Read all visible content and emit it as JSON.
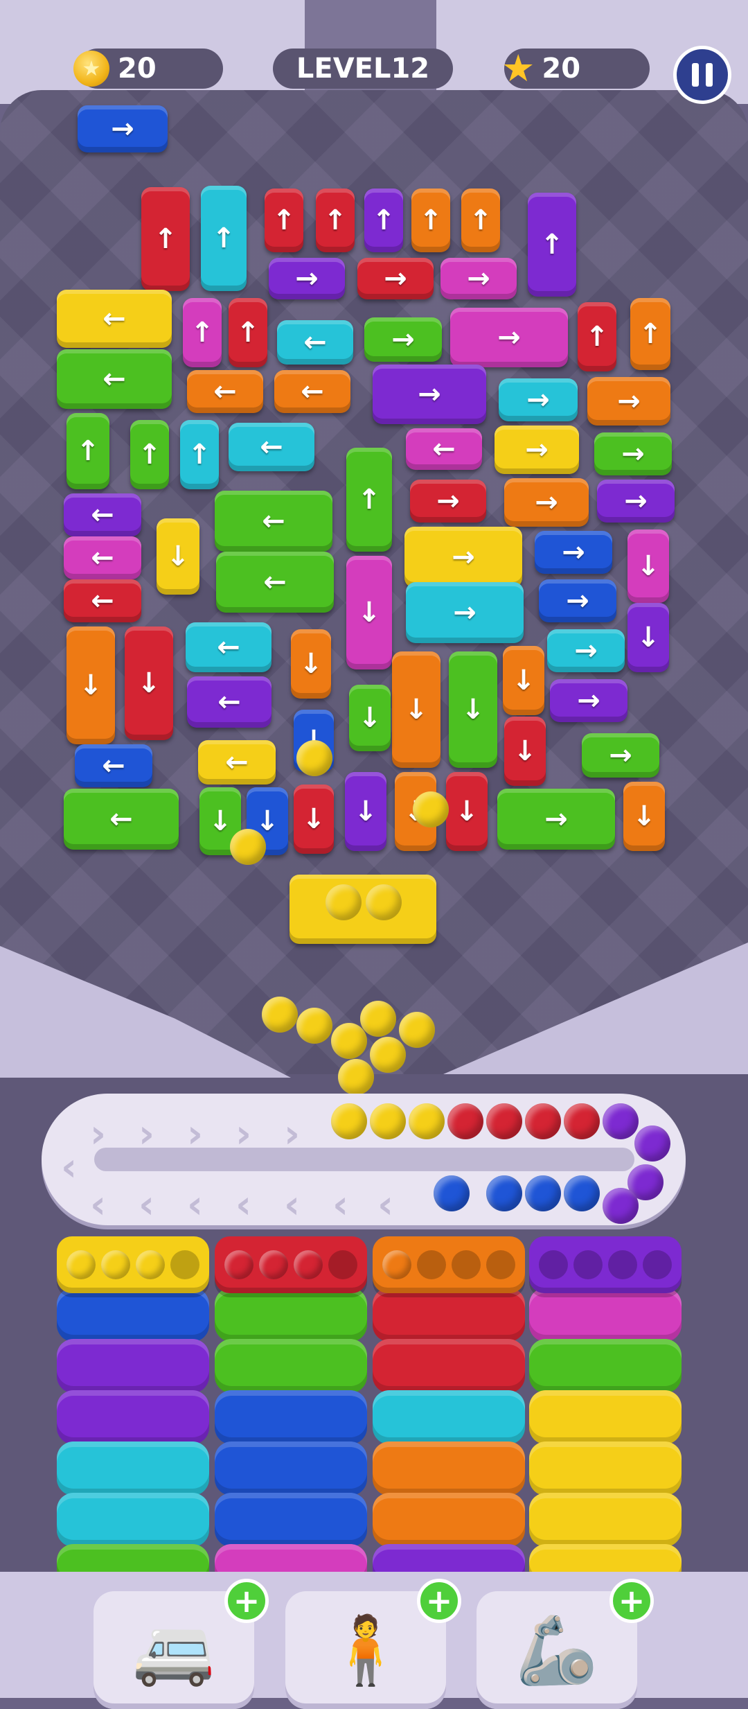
{
  "hud": {
    "coins": "20",
    "level": "LEVEL12",
    "stars": "20",
    "coin_icon": "coin-icon",
    "star_icon": "star-icon",
    "pause_icon": "pause-icon"
  },
  "colors": {
    "red": "#d42433",
    "blue": "#1f55d6",
    "green": "#4cc021",
    "yellow": "#f5cf18",
    "orange": "#ee7a14",
    "purple": "#7d2ad1",
    "magenta": "#d43dbd",
    "cyan": "#26c3d8"
  },
  "parking": {
    "arrow_glyphs": {
      "up": "↑",
      "down": "↓",
      "left": "←",
      "right": "→"
    }
  },
  "conveyor": {
    "balls": [
      "yellow",
      "yellow",
      "yellow",
      "red",
      "red",
      "red",
      "red",
      "purple",
      "purple",
      "purple",
      "purple",
      "blue",
      "blue",
      "blue",
      "blue"
    ]
  },
  "columns": [
    {
      "tray_color": "yellow",
      "filled_slots": 3,
      "blocks": [
        "blue",
        "purple",
        "purple",
        "cyan",
        "cyan",
        "green"
      ]
    },
    {
      "tray_color": "red",
      "filled_slots": 3,
      "blocks": [
        "green",
        "green",
        "blue",
        "blue",
        "blue",
        "magenta"
      ]
    },
    {
      "tray_color": "orange",
      "filled_slots": 1,
      "blocks": [
        "red",
        "red",
        "cyan",
        "orange",
        "orange",
        "purple"
      ]
    },
    {
      "tray_color": "purple",
      "filled_slots": 0,
      "blocks": [
        "magenta",
        "green",
        "yellow",
        "yellow",
        "yellow",
        "yellow"
      ]
    }
  ],
  "powerups": [
    {
      "name": "rainbow-car",
      "icon": "🚐",
      "add": "+"
    },
    {
      "name": "swap-person",
      "icon": "🧍",
      "add": "+"
    },
    {
      "name": "claw",
      "icon": "🦾",
      "add": "+"
    }
  ]
}
